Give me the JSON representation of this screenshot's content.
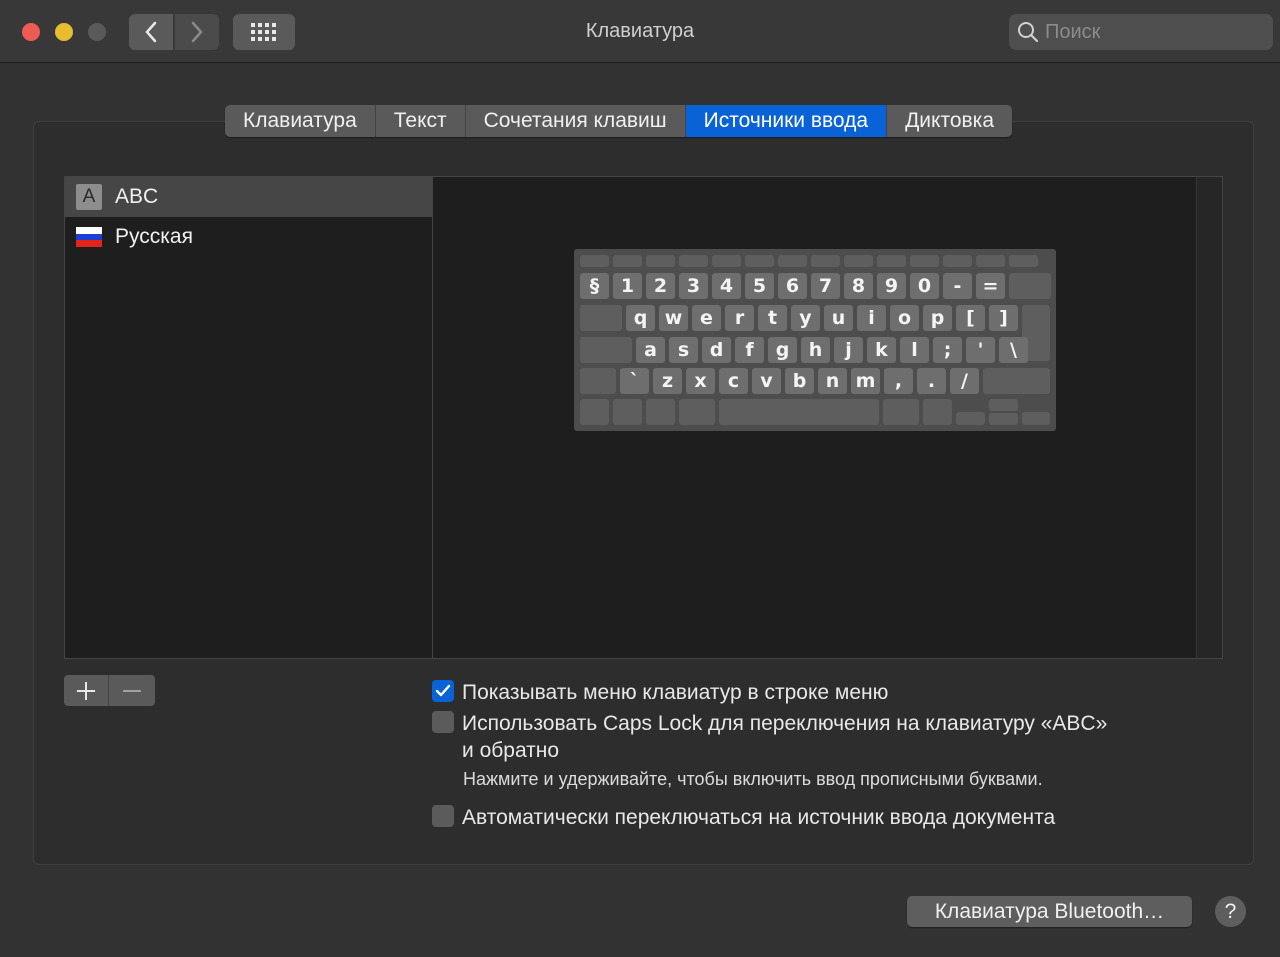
{
  "window": {
    "title": "Клавиатура"
  },
  "search": {
    "placeholder": "Поиск"
  },
  "tabs": [
    {
      "label": "Клавиатура",
      "active": false
    },
    {
      "label": "Текст",
      "active": false
    },
    {
      "label": "Сочетания клавиш",
      "active": false
    },
    {
      "label": "Источники ввода",
      "active": true
    },
    {
      "label": "Диктовка",
      "active": false
    }
  ],
  "sources": [
    {
      "label": "ABC",
      "icon_letter": "A",
      "selected": true
    },
    {
      "label": "Русская",
      "icon": "russia-flag-icon",
      "selected": false
    }
  ],
  "keyboard": {
    "row1": [
      "§",
      "1",
      "2",
      "3",
      "4",
      "5",
      "6",
      "7",
      "8",
      "9",
      "0",
      "-",
      "="
    ],
    "row2": [
      "q",
      "w",
      "e",
      "r",
      "t",
      "y",
      "u",
      "i",
      "o",
      "p",
      "[",
      "]"
    ],
    "row3": [
      "a",
      "s",
      "d",
      "f",
      "g",
      "h",
      "j",
      "k",
      "l",
      ";",
      "'",
      "\\"
    ],
    "row4": [
      "`",
      "z",
      "x",
      "c",
      "v",
      "b",
      "n",
      "m",
      ",",
      ".",
      "/"
    ]
  },
  "options": {
    "show_menu": {
      "label": "Показывать меню клавиатур в строке меню",
      "checked": true
    },
    "caps_lock": {
      "label_line1": "Использовать Caps Lock для переключения на клавиатуру «ABC»",
      "label_line2": "и обратно",
      "checked": false
    },
    "caps_hint": "Нажмите и удерживайте, чтобы включить ввод прописными буквами.",
    "auto_switch": {
      "label": "Автоматически переключаться на источник ввода документа",
      "checked": false
    }
  },
  "footer": {
    "bluetooth_button": "Клавиатура Bluetooth…",
    "help_label": "?"
  },
  "colors": {
    "accent": "#0a63d6",
    "window_bg": "#323232",
    "list_bg": "#1e1e1e"
  }
}
